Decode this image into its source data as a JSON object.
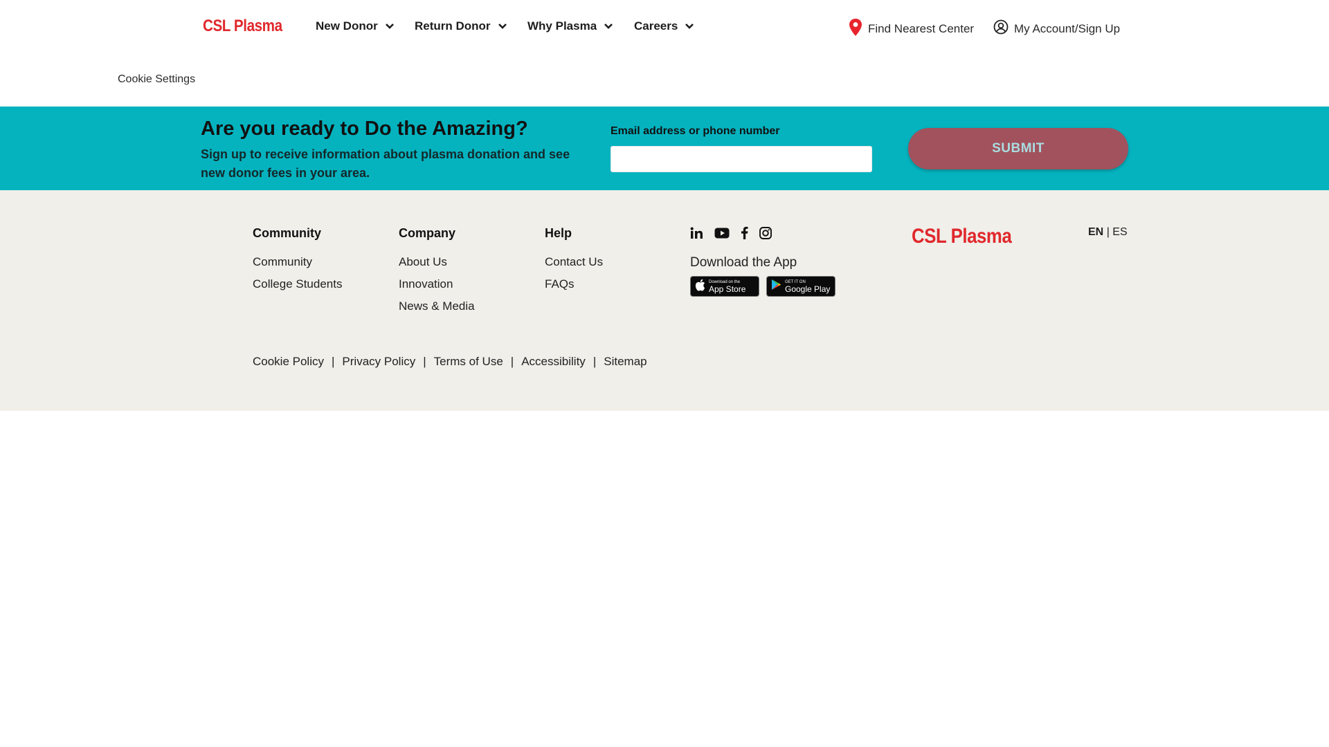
{
  "header": {
    "logo": "CSL Plasma",
    "nav": [
      {
        "label": "New Donor"
      },
      {
        "label": "Return Donor"
      },
      {
        "label": "Why Plasma"
      },
      {
        "label": "Careers"
      }
    ],
    "find_center": "Find Nearest Center",
    "account": "My Account/Sign Up"
  },
  "cookie_settings": "Cookie Settings",
  "signup": {
    "title": "Are you ready to Do the Amazing?",
    "description": "Sign up to receive information about plasma donation and see new donor fees in your area.",
    "email_label": "Email address or phone number",
    "email_value": "",
    "submit": "SUBMIT"
  },
  "footer": {
    "columns": [
      {
        "heading": "Community",
        "links": [
          "Community",
          "College Students"
        ]
      },
      {
        "heading": "Company",
        "links": [
          "About Us",
          "Innovation",
          "News & Media"
        ]
      },
      {
        "heading": "Help",
        "links": [
          "Contact Us",
          "FAQs"
        ]
      }
    ],
    "social_icons": [
      "linkedin-icon",
      "youtube-icon",
      "facebook-icon",
      "instagram-icon"
    ],
    "download_label": "Download the App",
    "app_store": {
      "small": "Download on the",
      "big": "App Store"
    },
    "google_play": {
      "small": "GET IT ON",
      "big": "Google Play"
    },
    "logo": "CSL Plasma",
    "lang": {
      "en": "EN",
      "sep": "|",
      "es": "ES"
    },
    "legal": [
      "Cookie Policy",
      "Privacy Policy",
      "Terms of Use",
      "Accessibility",
      "Sitemap"
    ],
    "legal_sep": "|"
  },
  "colors": {
    "brand_red": "#e0282c",
    "teal_band": "#05b3bf",
    "submit_bg": "#a2525d",
    "footer_bg": "#f0efea"
  }
}
